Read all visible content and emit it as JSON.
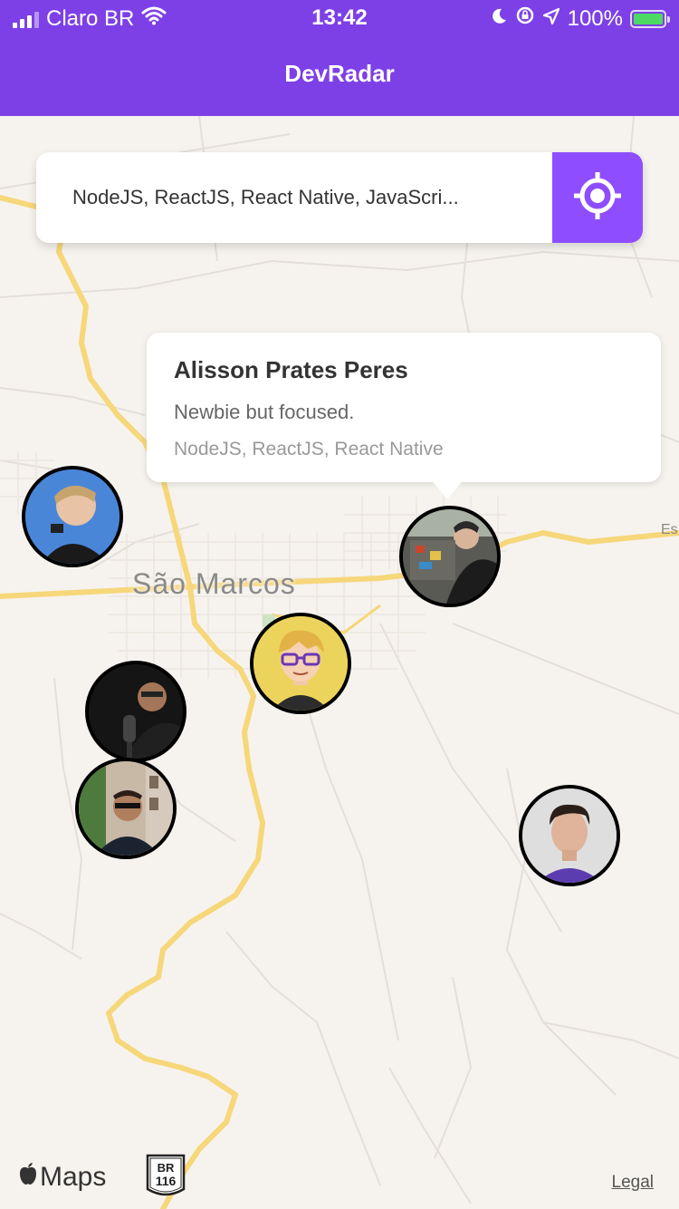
{
  "status_bar": {
    "carrier": "Claro BR",
    "time": "13:42",
    "battery": "100%"
  },
  "header": {
    "title": "DevRadar"
  },
  "search": {
    "value": "NodeJS, ReactJS, React Native, JavaScript",
    "display": "NodeJS, ReactJS, React Native, JavaScri..."
  },
  "callout": {
    "name": "Alisson Prates Peres",
    "bio": "Newbie but focused.",
    "techs": "NodeJS, ReactJS, React Native"
  },
  "map": {
    "town": "São Marcos",
    "road_label": "Es",
    "shield_top": "BR",
    "shield_bottom": "116",
    "maps_brand": "Maps",
    "legal": "Legal"
  },
  "colors": {
    "accent": "#7d40e7",
    "button": "#8e4dff",
    "marker_border": "#000000"
  }
}
